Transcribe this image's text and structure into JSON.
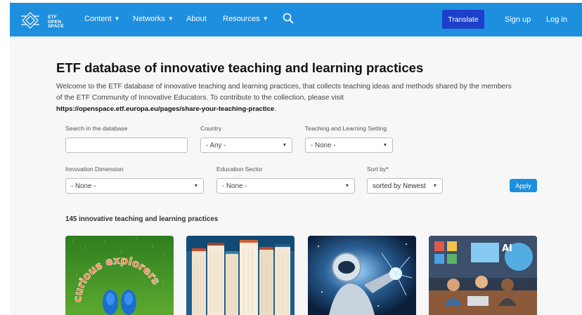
{
  "nav": {
    "logo_lines": [
      "ETF",
      "OPEN",
      "SPACE"
    ],
    "items": [
      {
        "label": "Content",
        "has_dropdown": true
      },
      {
        "label": "Networks",
        "has_dropdown": true
      },
      {
        "label": "About",
        "has_dropdown": false
      },
      {
        "label": "Resources",
        "has_dropdown": true
      }
    ],
    "search_icon": "search-icon",
    "translate_label": "Translate",
    "signup_label": "Sign up",
    "login_label": "Log in",
    "bar_color": "#1e8fdf",
    "translate_color": "#1d3fc9"
  },
  "page": {
    "title": "ETF database of innovative teaching and learning practices",
    "intro": "Welcome to the ETF database of innovative teaching and learning practices, that collects teaching ideas and methods shared by the members of the ETF Community of Innovative Educators. To contribute to the collection, please visit",
    "intro_url": "https://openspace.etf.europa.eu/pages/share-your-teaching-practice",
    "intro_url_suffix": "."
  },
  "filters": {
    "search_label": "Search in the database",
    "search_value": "",
    "country_label": "Country",
    "country_value": "- Any -",
    "setting_label": "Teaching and Learning Setting",
    "setting_value": "- None -",
    "innovation_label": "Innovation Dimension",
    "innovation_value": "- None -",
    "sector_label": "Education Sector",
    "sector_value": "- None -",
    "sort_label": "Sort by",
    "sort_required": "*",
    "sort_value": "sorted by Newest",
    "apply_label": "Apply"
  },
  "results": {
    "count_text": "145 innovative teaching and learning practices",
    "cards": [
      {
        "image": "curious-explorers-image",
        "image_text": "curious explorers"
      },
      {
        "image": "books-image"
      },
      {
        "image": "astronaut-robot-image"
      },
      {
        "image": "ai-classroom-image",
        "image_text": "AI"
      }
    ]
  }
}
